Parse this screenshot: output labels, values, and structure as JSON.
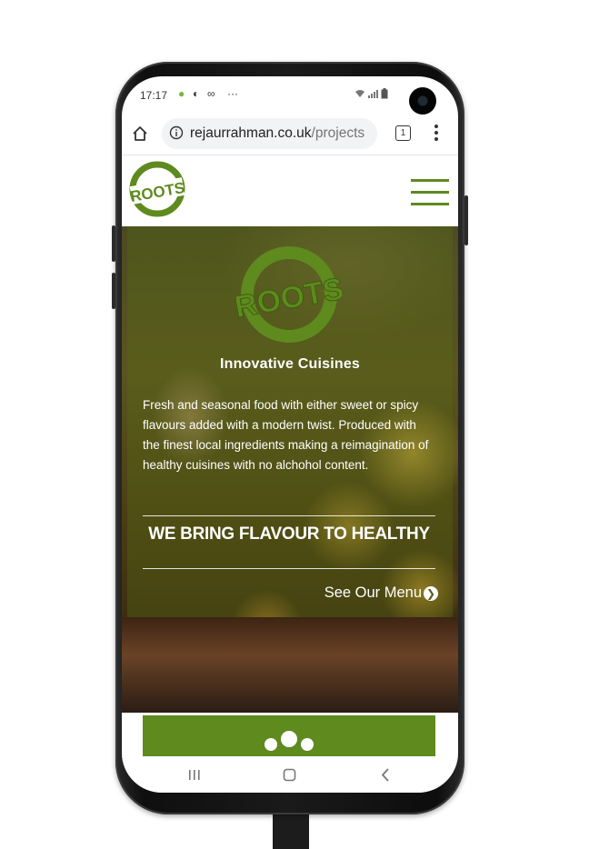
{
  "status_bar": {
    "time": "17:17",
    "icons": [
      "android-icon",
      "sync-icon",
      "link-icon",
      "more-icon",
      "wifi-icon",
      "signal-icon",
      "battery-icon"
    ],
    "more": "···"
  },
  "browser": {
    "url_domain": "rejaurrahman.co.uk",
    "url_path": "/projects",
    "tab_count": "1"
  },
  "site": {
    "logo_text": "ROOTS",
    "brand_color": "#5e8a1e"
  },
  "hero": {
    "heading": "Innovative Cuisines",
    "paragraph": "Fresh and seasonal food with either sweet or spicy flavours added with a modern twist. Produced with the finest local ingredients making a reimagination of healthy cuisines with no alchohol content.",
    "tagline": "WE BRING FLAVOUR TO HEALTHY",
    "link_label": "See Our Menu"
  },
  "feature": {
    "icon": "group-icon"
  },
  "nav_bar": {
    "recents_label": "|||",
    "home_icon": "home-circle-icon",
    "back_label": "<"
  }
}
